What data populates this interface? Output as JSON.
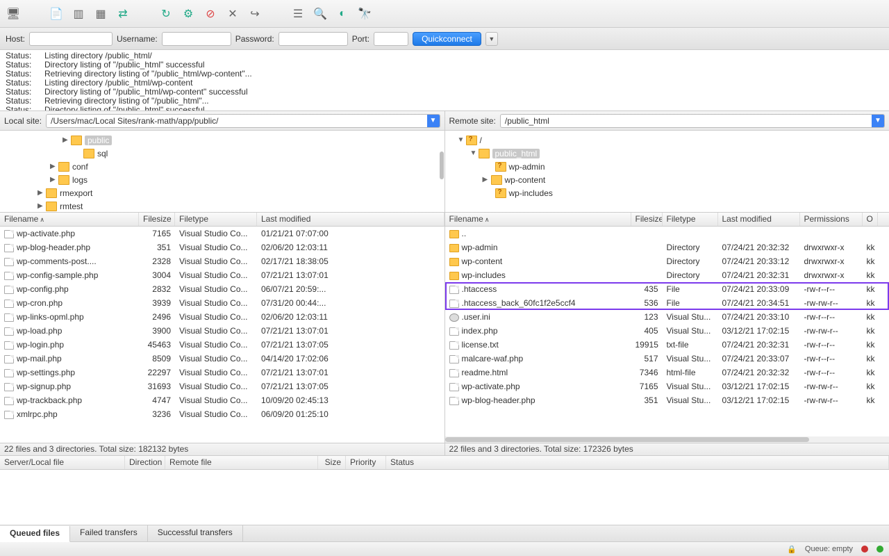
{
  "quickconnect": {
    "host_label": "Host:",
    "user_label": "Username:",
    "pass_label": "Password:",
    "port_label": "Port:",
    "button": "Quickconnect"
  },
  "log": [
    "Listing directory /public_html/",
    "Directory listing of \"/public_html\" successful",
    "Retrieving directory listing of \"/public_html/wp-content\"...",
    "Listing directory /public_html/wp-content",
    "Directory listing of \"/public_html/wp-content\" successful",
    "Retrieving directory listing of \"/public_html\"...",
    "Directory listing of \"/public_html\" successful"
  ],
  "log_label": "Status:",
  "local": {
    "site_label": "Local site:",
    "site_path": "/Users/mac/Local Sites/rank-math/app/public/",
    "tree": [
      {
        "indent": 90,
        "arrow": "▶",
        "ico": "folder",
        "label": "public",
        "sel": true
      },
      {
        "indent": 108,
        "arrow": "",
        "ico": "folder",
        "label": "sql"
      },
      {
        "indent": 72,
        "arrow": "▶",
        "ico": "folder",
        "label": "conf"
      },
      {
        "indent": 72,
        "arrow": "▶",
        "ico": "folder",
        "label": "logs"
      },
      {
        "indent": 54,
        "arrow": "▶",
        "ico": "folder",
        "label": "rmexport"
      },
      {
        "indent": 54,
        "arrow": "▶",
        "ico": "folder",
        "label": "rmtest"
      }
    ],
    "cols": {
      "name": "Filename",
      "size": "Filesize",
      "type": "Filetype",
      "mod": "Last modified"
    },
    "rows": [
      {
        "ico": "file",
        "name": "wp-activate.php",
        "size": "7165",
        "type": "Visual Studio Co...",
        "mod": "01/21/21 07:07:00"
      },
      {
        "ico": "file",
        "name": "wp-blog-header.php",
        "size": "351",
        "type": "Visual Studio Co...",
        "mod": "02/06/20 12:03:11"
      },
      {
        "ico": "file",
        "name": "wp-comments-post....",
        "size": "2328",
        "type": "Visual Studio Co...",
        "mod": "02/17/21 18:38:05"
      },
      {
        "ico": "file",
        "name": "wp-config-sample.php",
        "size": "3004",
        "type": "Visual Studio Co...",
        "mod": "07/21/21 13:07:01"
      },
      {
        "ico": "file",
        "name": "wp-config.php",
        "size": "2832",
        "type": "Visual Studio Co...",
        "mod": "06/07/21 20:59:..."
      },
      {
        "ico": "file",
        "name": "wp-cron.php",
        "size": "3939",
        "type": "Visual Studio Co...",
        "mod": "07/31/20 00:44:..."
      },
      {
        "ico": "file",
        "name": "wp-links-opml.php",
        "size": "2496",
        "type": "Visual Studio Co...",
        "mod": "02/06/20 12:03:11"
      },
      {
        "ico": "file",
        "name": "wp-load.php",
        "size": "3900",
        "type": "Visual Studio Co...",
        "mod": "07/21/21 13:07:01"
      },
      {
        "ico": "file",
        "name": "wp-login.php",
        "size": "45463",
        "type": "Visual Studio Co...",
        "mod": "07/21/21 13:07:05"
      },
      {
        "ico": "file",
        "name": "wp-mail.php",
        "size": "8509",
        "type": "Visual Studio Co...",
        "mod": "04/14/20 17:02:06"
      },
      {
        "ico": "file",
        "name": "wp-settings.php",
        "size": "22297",
        "type": "Visual Studio Co...",
        "mod": "07/21/21 13:07:01"
      },
      {
        "ico": "file",
        "name": "wp-signup.php",
        "size": "31693",
        "type": "Visual Studio Co...",
        "mod": "07/21/21 13:07:05"
      },
      {
        "ico": "file",
        "name": "wp-trackback.php",
        "size": "4747",
        "type": "Visual Studio Co...",
        "mod": "10/09/20 02:45:13"
      },
      {
        "ico": "file",
        "name": "xmlrpc.php",
        "size": "3236",
        "type": "Visual Studio Co...",
        "mod": "06/09/20 01:25:10"
      }
    ],
    "status": "22 files and 3 directories. Total size: 182132 bytes"
  },
  "remote": {
    "site_label": "Remote site:",
    "site_path": "/public_html",
    "tree": [
      {
        "indent": 18,
        "arrow": "▼",
        "ico": "folder-q",
        "label": "/"
      },
      {
        "indent": 36,
        "arrow": "▼",
        "ico": "folder",
        "label": "public_html",
        "sel": true
      },
      {
        "indent": 60,
        "arrow": "",
        "ico": "folder-q",
        "label": "wp-admin"
      },
      {
        "indent": 54,
        "arrow": "▶",
        "ico": "folder",
        "label": "wp-content"
      },
      {
        "indent": 60,
        "arrow": "",
        "ico": "folder-q",
        "label": "wp-includes"
      }
    ],
    "cols": {
      "name": "Filename",
      "size": "Filesize",
      "type": "Filetype",
      "mod": "Last modified",
      "perm": "Permissions",
      "own": "O"
    },
    "rows": [
      {
        "ico": "folder",
        "name": "..",
        "size": "",
        "type": "",
        "mod": "",
        "perm": "",
        "own": ""
      },
      {
        "ico": "folder",
        "name": "wp-admin",
        "size": "",
        "type": "Directory",
        "mod": "07/24/21 20:32:32",
        "perm": "drwxrwxr-x",
        "own": "kk"
      },
      {
        "ico": "folder",
        "name": "wp-content",
        "size": "",
        "type": "Directory",
        "mod": "07/24/21 20:33:12",
        "perm": "drwxrwxr-x",
        "own": "kk"
      },
      {
        "ico": "folder",
        "name": "wp-includes",
        "size": "",
        "type": "Directory",
        "mod": "07/24/21 20:32:31",
        "perm": "drwxrwxr-x",
        "own": "kk"
      },
      {
        "ico": "file",
        "name": ".htaccess",
        "size": "435",
        "type": "File",
        "mod": "07/24/21 20:33:09",
        "perm": "-rw-r--r--",
        "own": "kk"
      },
      {
        "ico": "file",
        "name": ".htaccess_back_60fc1f2e5ccf4",
        "size": "536",
        "type": "File",
        "mod": "07/24/21 20:34:51",
        "perm": "-rw-rw-r--",
        "own": "kk"
      },
      {
        "ico": "gear",
        "name": ".user.ini",
        "size": "123",
        "type": "Visual Stu...",
        "mod": "07/24/21 20:33:10",
        "perm": "-rw-r--r--",
        "own": "kk"
      },
      {
        "ico": "file",
        "name": "index.php",
        "size": "405",
        "type": "Visual Stu...",
        "mod": "03/12/21 17:02:15",
        "perm": "-rw-rw-r--",
        "own": "kk"
      },
      {
        "ico": "file",
        "name": "license.txt",
        "size": "19915",
        "type": "txt-file",
        "mod": "07/24/21 20:32:31",
        "perm": "-rw-r--r--",
        "own": "kk"
      },
      {
        "ico": "file",
        "name": "malcare-waf.php",
        "size": "517",
        "type": "Visual Stu...",
        "mod": "07/24/21 20:33:07",
        "perm": "-rw-r--r--",
        "own": "kk"
      },
      {
        "ico": "file",
        "name": "readme.html",
        "size": "7346",
        "type": "html-file",
        "mod": "07/24/21 20:32:32",
        "perm": "-rw-r--r--",
        "own": "kk"
      },
      {
        "ico": "file",
        "name": "wp-activate.php",
        "size": "7165",
        "type": "Visual Stu...",
        "mod": "03/12/21 17:02:15",
        "perm": "-rw-rw-r--",
        "own": "kk"
      },
      {
        "ico": "file",
        "name": "wp-blog-header.php",
        "size": "351",
        "type": "Visual Stu...",
        "mod": "03/12/21 17:02:15",
        "perm": "-rw-rw-r--",
        "own": "kk"
      }
    ],
    "status": "22 files and 3 directories. Total size: 172326 bytes"
  },
  "transfer_cols": {
    "server": "Server/Local file",
    "dir": "Direction",
    "remote": "Remote file",
    "size": "Size",
    "prio": "Priority",
    "status": "Status"
  },
  "tabs": {
    "queued": "Queued files",
    "failed": "Failed transfers",
    "success": "Successful transfers"
  },
  "statusbar": {
    "queue": "Queue: empty"
  }
}
